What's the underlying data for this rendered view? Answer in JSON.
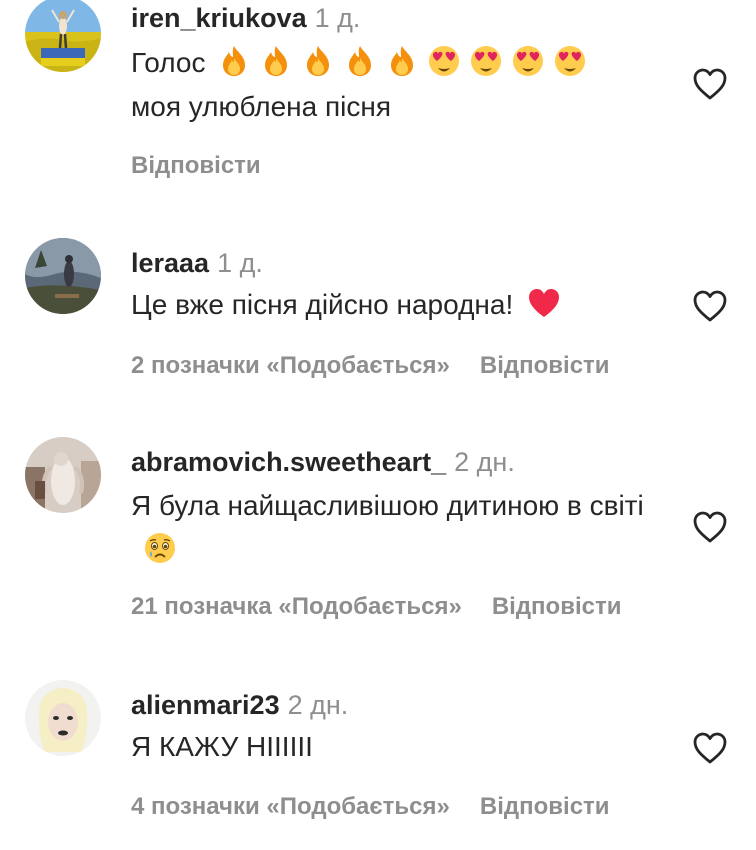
{
  "comments": [
    {
      "username": "iren_kriukova",
      "time": "1 д.",
      "text_line1": "Голос",
      "emojis": [
        "fire-emoji",
        "fire-emoji",
        "fire-emoji",
        "fire-emoji",
        "fire-emoji",
        "heart-eyes-emoji",
        "heart-eyes-emoji",
        "heart-eyes-emoji",
        "heart-eyes-emoji"
      ],
      "text_line2": "моя улюблена пісня",
      "likes": "",
      "reply": "Відповісти"
    },
    {
      "username": "leraaa",
      "time": "1 д.",
      "text": "Це вже пісня дійсно народна!",
      "emoji": "red-heart-emoji",
      "likes": "2 позначки «Подобається»",
      "reply": "Відповісти"
    },
    {
      "username": "abramovich.sweetheart_",
      "time": "2 дн.",
      "text": "Я була найщасливішою дитиною в світі",
      "emoji": "crying-face-emoji",
      "likes": "21 позначка «Подобається»",
      "reply": "Відповісти"
    },
    {
      "username": "alienmari23",
      "time": "2 дн.",
      "text": "Я КАЖУ НІІІІІІ",
      "likes": "4 позначки «Подобається»",
      "reply": "Відповісти"
    }
  ],
  "icons": {
    "like": "heart-outline-icon"
  },
  "colors": {
    "text": "#262626",
    "secondary": "#8e8e8e",
    "background": "#ffffff"
  }
}
